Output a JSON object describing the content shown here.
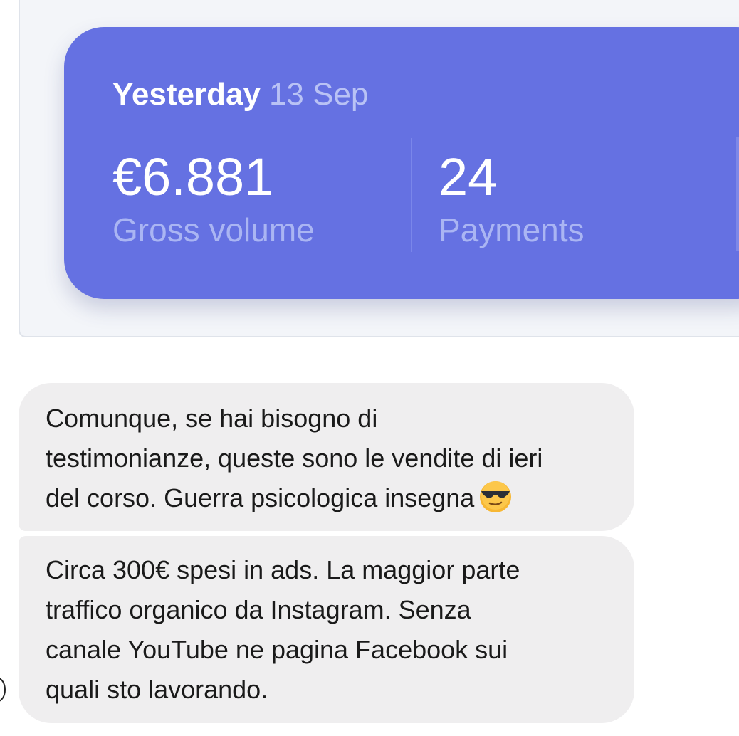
{
  "dashboard": {
    "date_label": "Yesterday",
    "date_value": "13 Sep",
    "gross_volume": {
      "value": "€6.881",
      "label": "Gross volume"
    },
    "payments": {
      "value": "24",
      "label": "Payments"
    },
    "colors": {
      "card": "#6571e2",
      "panel": "#f3f5f9"
    }
  },
  "messages": [
    {
      "lines": [
        "Comunque, se hai bisogno di",
        "testimonianze, queste sono le vendite di ieri",
        "del corso. Guerra psicologica insegna"
      ],
      "emoji": "smiling-face-with-sunglasses"
    },
    {
      "lines": [
        "Circa 300€ spesi in ads. La maggior parte",
        "traffico organico da Instagram. Senza",
        "canale YouTube ne pagina Facebook sui",
        "quali sto lavorando."
      ]
    }
  ],
  "colors": {
    "bubble": "#efeeef",
    "text": "#1a1a1a"
  }
}
